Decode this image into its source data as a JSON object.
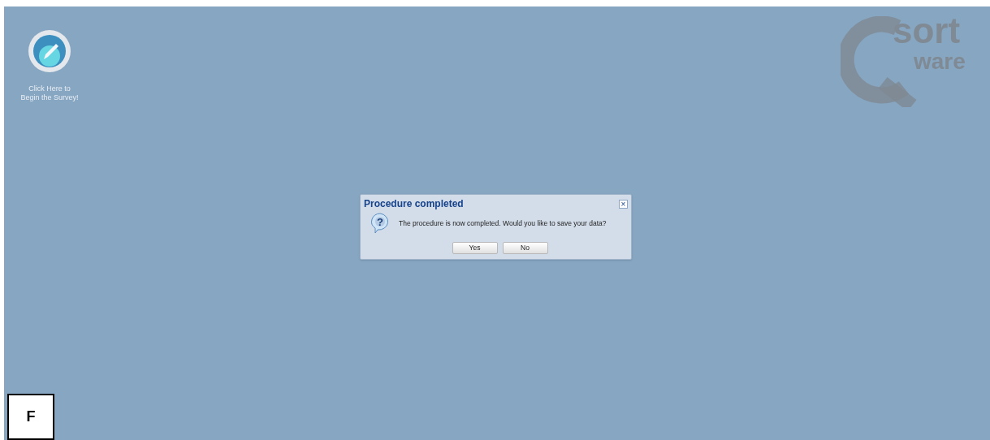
{
  "desktop_icon": {
    "label_lines": [
      "Click Here to",
      "Begin the Survey!"
    ]
  },
  "logo": {
    "word_1": "sort",
    "word_2": "ware"
  },
  "dialog": {
    "title": "Procedure completed",
    "message": "The procedure is now completed. Would you like to save your data?",
    "close": "×",
    "icon_glyph": "?",
    "buttons": [
      "Yes",
      "No"
    ]
  },
  "panel_label": "F"
}
